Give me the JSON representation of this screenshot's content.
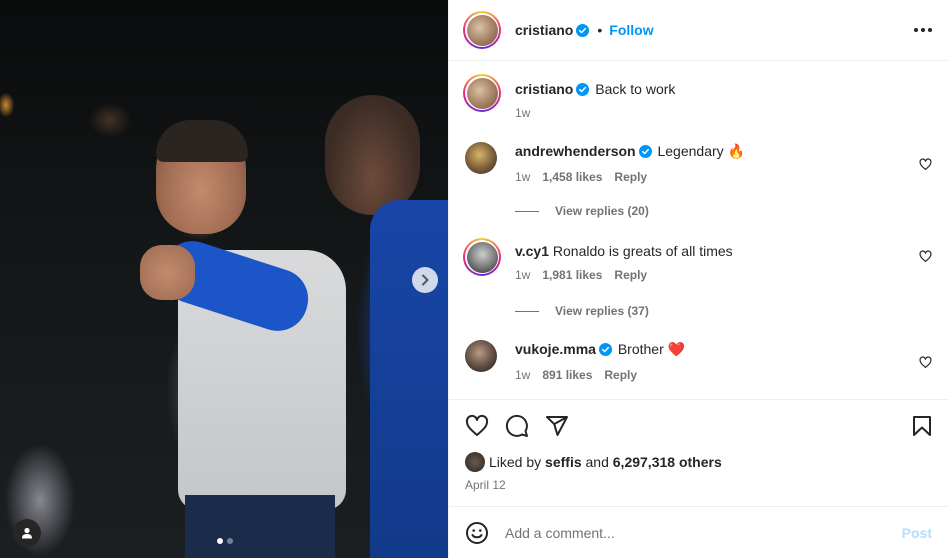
{
  "post": {
    "author": "cristiano",
    "follow_label": "Follow",
    "separator": "•",
    "caption": "Back to work",
    "caption_age": "1w"
  },
  "comments": [
    {
      "user": "andrewhenderson",
      "text": "Legendary",
      "emoji": "🔥",
      "age": "1w",
      "likes": "1,458 likes",
      "reply": "Reply",
      "replies": "View replies (20)"
    },
    {
      "user": "v.cy1",
      "text": "Ronaldo is greats of all times",
      "age": "1w",
      "likes": "1,981 likes",
      "reply": "Reply",
      "replies": "View replies (37)"
    },
    {
      "user": "vukoje.mma",
      "text": "Brother",
      "emoji": "❤️",
      "age": "1w",
      "likes": "891 likes",
      "reply": "Reply"
    }
  ],
  "likes": {
    "prefix": "Liked by",
    "user": "seffis",
    "and": "and",
    "count": "6,297,318 others"
  },
  "date": "April 12",
  "composer": {
    "placeholder": "Add a comment...",
    "post_label": "Post"
  },
  "carousel": {
    "total": 2,
    "current": 1
  },
  "colors": {
    "accent": "#0095f6",
    "verified": "#0095f6",
    "text": "#262626",
    "muted": "#737373"
  }
}
